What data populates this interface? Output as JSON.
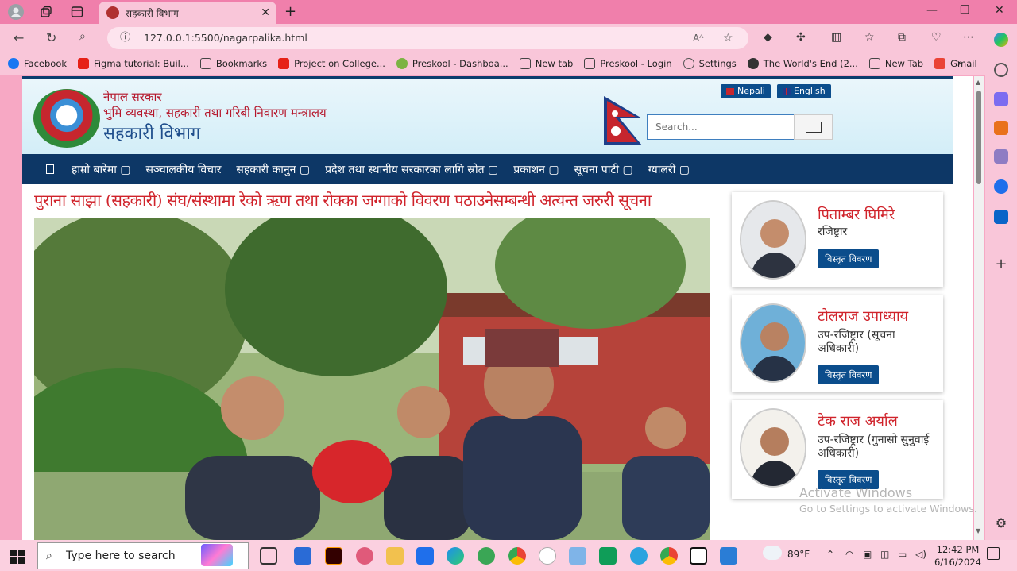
{
  "browser": {
    "tab_title": "सहकारी विभाग",
    "url": "127.0.0.1:5500/nagarpalika.html",
    "bookmarks": [
      {
        "label": "Facebook",
        "color": "#1877f2"
      },
      {
        "label": "Figma tutorial: Buil...",
        "color": "#e62117"
      },
      {
        "label": "Bookmarks",
        "color": "#ffffff"
      },
      {
        "label": "Project on College...",
        "color": "#e62117"
      },
      {
        "label": "Preskool - Dashboa...",
        "color": "#7cb342"
      },
      {
        "label": "New tab",
        "color": "#ffffff"
      },
      {
        "label": "Preskool - Login",
        "color": "#ffffff"
      },
      {
        "label": "Settings",
        "color": "#555555"
      },
      {
        "label": "The World's End (2...",
        "color": "#333333"
      },
      {
        "label": "New Tab",
        "color": "#ffffff"
      },
      {
        "label": "Gmail",
        "color": "#ea4335"
      }
    ]
  },
  "site": {
    "gov_line1": "नेपाल सरकार",
    "gov_line2": "भुमि व्यवस्था, सहकारी तथा गरिबी निवारण मन्त्रालय",
    "dept_name": "सहकारी विभाग",
    "lang_nepali": "Nepali",
    "lang_english": "English",
    "search_placeholder": "Search...",
    "nav": [
      "हाम्रो बारेमा ▢",
      "सञ्चालकीय विचार",
      "सहकारी कानुन ▢",
      "प्रदेश तथा स्थानीय सरकारका लागि स्रोत ▢",
      "प्रकाशन ▢",
      "सूचना पाटी ▢",
      "ग्यालरी ▢"
    ],
    "headline": "पुराना साझा (सहकारी) संघ/संस्थामा रेको ऋण तथा रोक्का जग्गाको विवरण पठाउनेसम्बन्धी अत्यन्त जरुरी सूचना",
    "officials": [
      {
        "name": "पिताम्बर घिमिरे",
        "role": "रजिष्ट्रार",
        "button": "विस्तृत विवरण"
      },
      {
        "name": "टोलराज उपाध्याय",
        "role": "उप-रजिष्ट्रार (सूचना अधिकारी)",
        "button": "विस्तृत विवरण"
      },
      {
        "name": "टेक राज अर्याल",
        "role": "उप-रजिष्ट्रार (गुनासो सुनुवाई अधिकारी)",
        "button": "विस्तृत विवरण"
      }
    ]
  },
  "os": {
    "watermark_title": "Activate Windows",
    "watermark_sub": "Go to Settings to activate Windows.",
    "search_placeholder": "Type here to search",
    "weather": "89°F",
    "time": "12:42 PM",
    "date": "6/16/2024"
  },
  "colors": {
    "accent_red": "#d0232b",
    "nav_blue": "#0d3766",
    "button_blue": "#0b4d8c",
    "chrome_pink": "#f07fab"
  }
}
